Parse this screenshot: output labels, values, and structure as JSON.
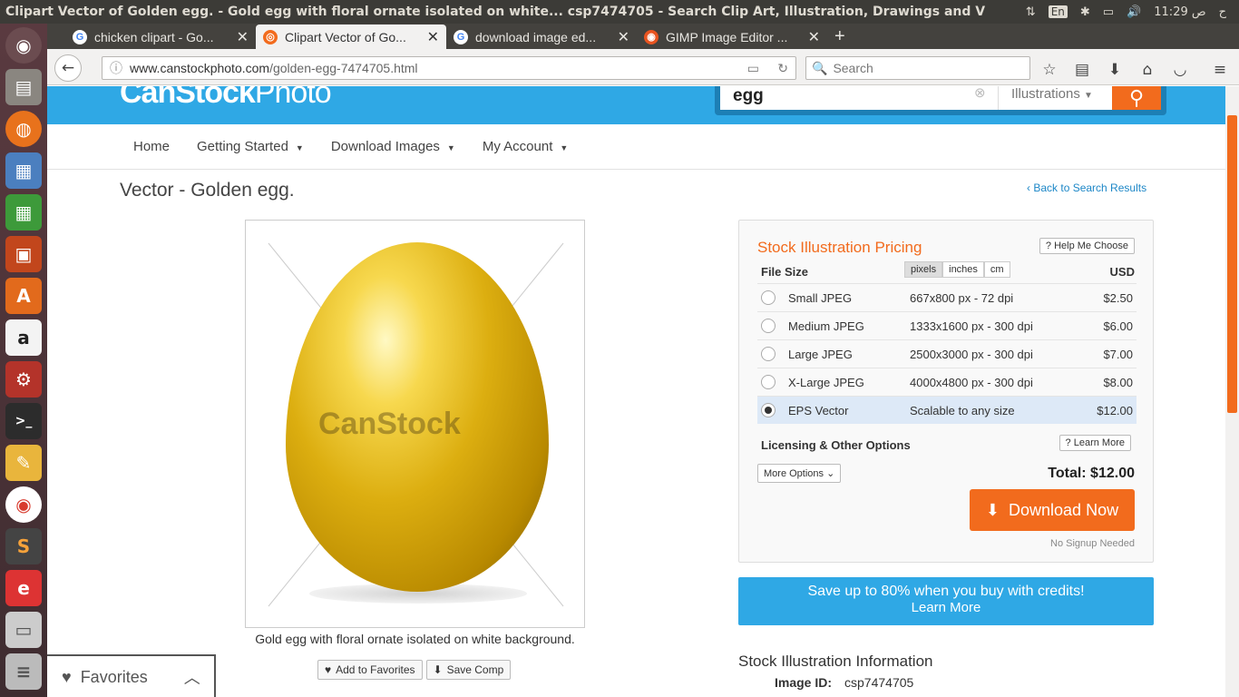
{
  "os": {
    "window_title": "Clipart Vector of Golden egg. - Gold egg with floral ornate isolated on white... csp7474705 - Search Clip Art, Illustration, Drawings and Vector EPS Gr",
    "keyboard_layout": "En",
    "clock": "11:29 ص",
    "locale_label": "ح",
    "launcher_items": [
      "ubuntu-dash",
      "files",
      "firefox",
      "writer",
      "calc",
      "impress",
      "software-center",
      "amazon",
      "settings",
      "terminal",
      "text-editor",
      "chrome",
      "sublime-text",
      "evince",
      "disk",
      "stack"
    ]
  },
  "browser": {
    "tabs": [
      {
        "label": "chicken clipart - Go...",
        "favicon": "G",
        "active": false
      },
      {
        "label": "Clipart Vector of Go...",
        "favicon": "canstock",
        "active": true
      },
      {
        "label": "download image ed...",
        "favicon": "G",
        "active": false
      },
      {
        "label": "GIMP Image Editor ...",
        "favicon": "ubuntu",
        "active": false
      }
    ],
    "url_domain": "www.canstockphoto.com",
    "url_path": "/golden-egg-7474705.html",
    "search_placeholder": "Search"
  },
  "site": {
    "logo_bold": "CanStock",
    "logo_thin": "Photo",
    "search_value": "egg",
    "search_category": "Illustrations",
    "menu": [
      "Home",
      "Getting Started",
      "Download Images",
      "My Account"
    ],
    "page_title": "Vector - Golden egg.",
    "back_link": "Back to Search Results",
    "watermark": "CanStock",
    "caption": "Gold egg with floral ornate isolated on white background.",
    "add_favorites": "Add to Favorites",
    "save_comp": "Save Comp",
    "favorites_label": "Favorites"
  },
  "pricing": {
    "heading": "Stock Illustration Pricing",
    "help_button": "Help Me Choose",
    "file_size_label": "File Size",
    "units": [
      "pixels",
      "inches",
      "cm"
    ],
    "currency": "USD",
    "options": [
      {
        "name": "Small JPEG",
        "dims": "667x800 px - 72 dpi",
        "price": "$2.50",
        "selected": false
      },
      {
        "name": "Medium JPEG",
        "dims": "1333x1600 px - 300 dpi",
        "price": "$6.00",
        "selected": false
      },
      {
        "name": "Large JPEG",
        "dims": "2500x3000 px - 300 dpi",
        "price": "$7.00",
        "selected": false
      },
      {
        "name": "X-Large JPEG",
        "dims": "4000x4800 px - 300 dpi",
        "price": "$8.00",
        "selected": false
      },
      {
        "name": "EPS Vector",
        "dims": "Scalable to any size",
        "price": "$12.00",
        "selected": true
      }
    ],
    "licensing_label": "Licensing & Other Options",
    "learn_more": "Learn More",
    "more_options": "More Options",
    "total": "Total: $12.00",
    "download": "Download Now",
    "no_signup": "No Signup Needed"
  },
  "credits": {
    "text": "Save up to 80% when you buy with credits!",
    "link": "Learn More"
  },
  "info": {
    "heading": "Stock Illustration Information",
    "image_id_label": "Image ID:",
    "image_id": "csp7474705"
  },
  "colors": {
    "brand_blue": "#2fa8e5",
    "brand_orange": "#f26b1d"
  }
}
